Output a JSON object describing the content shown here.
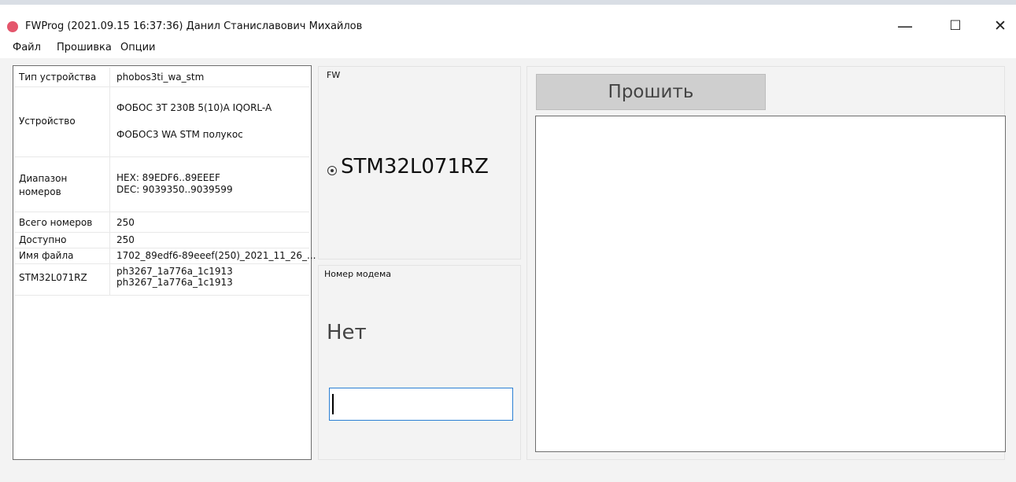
{
  "window": {
    "title": "FWProg (2021.09.15 16:37:36) Данил Станиславович Михайлов",
    "minimize": "—",
    "maximize": "☐",
    "close": "✕",
    "icon": "app-icon",
    "icon_color": "#e4566c"
  },
  "menu": {
    "file": "Файл",
    "firmware": "Прошивка",
    "options": "Опции"
  },
  "info": {
    "device_type": {
      "label": "Тип устройства",
      "value": "phobos3ti_wa_stm"
    },
    "device": {
      "label": "Устройство",
      "values": [
        "ФОБОС 3Т 230В 5(10)А IQORL-A",
        "ФОБОС3 WA STM полукос"
      ]
    },
    "range": {
      "label": "Диапазон номеров",
      "hex": "HEX: 89EDF6..89EEEF",
      "dec": "DEC: 9039350..9039599"
    },
    "total": {
      "label": "Всего номеров",
      "value": "250"
    },
    "available": {
      "label": "Доступно",
      "value": "250"
    },
    "filename": {
      "label": "Имя файла",
      "value": "1702_89edf6-89eeef(250)_2021_11_26_..."
    },
    "stm": {
      "label": "STM32L071RZ",
      "values": [
        "ph3267_1a776a_1c1913",
        "ph3267_1a776a_1c1913"
      ]
    }
  },
  "fw": {
    "label": "FW",
    "option": "STM32L071RZ",
    "selected": true
  },
  "modem": {
    "label": "Номер модема",
    "status": "Нет",
    "input_value": ""
  },
  "actions": {
    "flash": "Прошить"
  },
  "colors": {
    "input_border": "#2a7fd4",
    "button_bg": "#cfcfcf"
  }
}
